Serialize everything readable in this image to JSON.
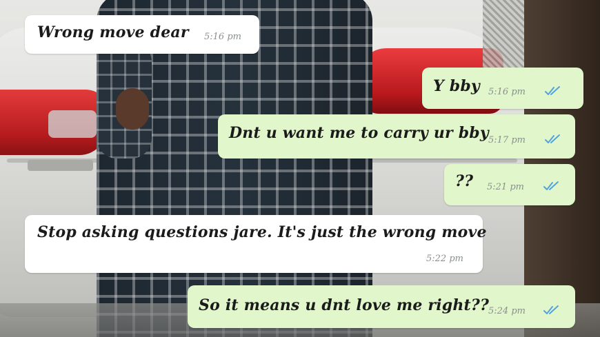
{
  "theme": {
    "incoming_bubble": "#ffffff",
    "outgoing_bubble": "#e1f7cb",
    "read_tick_color": "#4fa3e0",
    "timestamp_color": "#8a8f8a"
  },
  "messages": [
    {
      "direction": "incoming",
      "text": "Wrong move dear",
      "time": "5:16 pm"
    },
    {
      "direction": "outgoing",
      "text": "Y bby",
      "time": "5:16 pm",
      "status_icon": "double-check-read-icon"
    },
    {
      "direction": "outgoing",
      "text": "Dnt u want me to carry ur bby",
      "time": "5:17 pm",
      "status_icon": "double-check-read-icon"
    },
    {
      "direction": "outgoing",
      "text": "??",
      "time": "5:21 pm",
      "status_icon": "double-check-read-icon"
    },
    {
      "direction": "incoming",
      "text": "Stop asking questions jare. It's just the wrong move",
      "time": "5:22 pm"
    },
    {
      "direction": "outgoing",
      "text": "So it means u dnt love me right??",
      "time": "5:24 pm",
      "status_icon": "double-check-read-icon"
    }
  ]
}
